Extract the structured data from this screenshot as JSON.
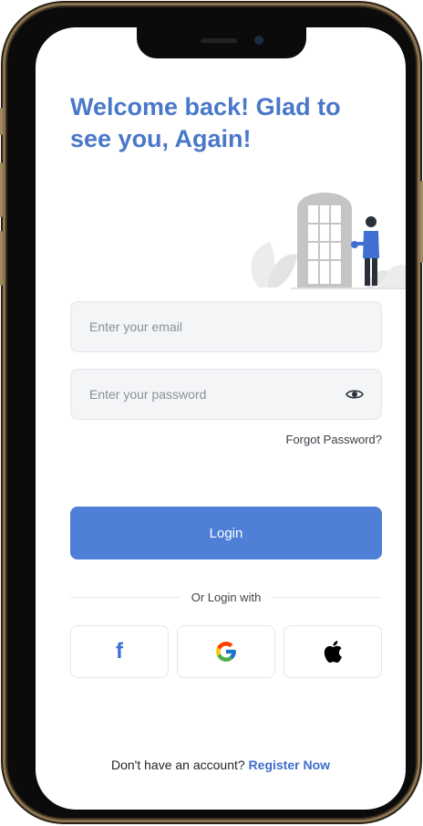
{
  "header": {
    "title": "Welcome back! Glad to see you, Again!"
  },
  "form": {
    "email_placeholder": "Enter your email",
    "password_placeholder": "Enter your password",
    "forgot_password": "Forgot Password?",
    "login_button": "Login"
  },
  "social": {
    "divider_text": "Or Login with",
    "providers": [
      {
        "name": "facebook",
        "icon": "facebook-icon",
        "glyph": "f",
        "color": "#3b6fd4"
      },
      {
        "name": "google",
        "icon": "google-icon",
        "color": "#4285f4"
      },
      {
        "name": "apple",
        "icon": "apple-icon",
        "color": "#000000"
      }
    ]
  },
  "footer": {
    "prompt": "Don't have an account?",
    "register_link": "Register Now"
  },
  "colors": {
    "accent": "#4f7fd6",
    "title": "#4a78c9",
    "link": "#3d6fc9"
  }
}
